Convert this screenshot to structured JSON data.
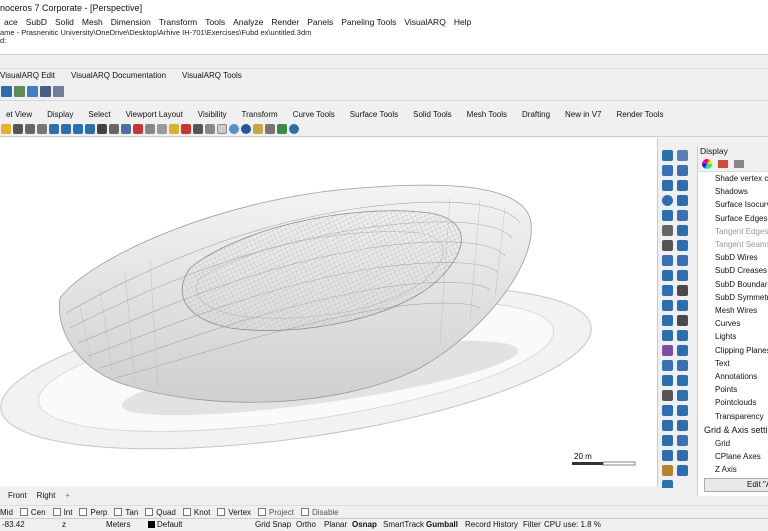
{
  "window": {
    "title": "noceros 7 Corporate - [Perspective]"
  },
  "menu": [
    "ace",
    "SubD",
    "Solid",
    "Mesh",
    "Dimension",
    "Transform",
    "Tools",
    "Analyze",
    "Render",
    "Panels",
    "Paneling Tools",
    "VisualARQ",
    "Help"
  ],
  "command_history": {
    "line1": "ame - Prasnenitic University\\OneDrive\\Desktop\\Arhive IH-701\\Exercises\\Fubd ex\\untitled.3dm",
    "line2": "d:"
  },
  "visualarq_tabs": [
    "VisualARQ Edit",
    "VisualARQ Documentation",
    "VisualARQ Tools"
  ],
  "main_tabs": [
    "et View",
    "Display",
    "Select",
    "Viewport Layout",
    "Visibility",
    "Transform",
    "Curve Tools",
    "Surface Tools",
    "Solid Tools",
    "Mesh Tools",
    "Drafting",
    "New in V7",
    "Render Tools"
  ],
  "viewport": {
    "name": "Perspective",
    "scale_label": "20 m"
  },
  "display_panel": {
    "header": "Display",
    "items": [
      {
        "label": "Shade vertex co",
        "dim": false
      },
      {
        "label": "Shadows",
        "dim": false
      },
      {
        "label": "Surface Isocurve",
        "dim": false
      },
      {
        "label": "Surface Edges",
        "dim": false
      },
      {
        "label": "Tangent Edges",
        "dim": true
      },
      {
        "label": "Tangent Seams",
        "dim": true
      },
      {
        "label": "SubD Wires",
        "dim": false
      },
      {
        "label": "SubD Creases",
        "dim": false
      },
      {
        "label": "SubD Boundarie",
        "dim": false
      },
      {
        "label": "SubD Symmetry",
        "dim": false
      },
      {
        "label": "Mesh Wires",
        "dim": false
      },
      {
        "label": "Curves",
        "dim": false
      },
      {
        "label": "Lights",
        "dim": false
      },
      {
        "label": "Clipping Planes",
        "dim": false
      },
      {
        "label": "Text",
        "dim": false
      },
      {
        "label": "Annotations",
        "dim": false
      },
      {
        "label": "Points",
        "dim": false
      },
      {
        "label": "Pointclouds",
        "dim": false
      },
      {
        "label": "Transparency",
        "dim": false
      }
    ],
    "grid_section": "Grid & Axis setti",
    "grid_items": [
      "Grid",
      "CPlane Axes",
      "Z Axis"
    ],
    "edit_button": "Edit \"A"
  },
  "view_tabs": [
    "Front",
    "Right",
    "+"
  ],
  "osnaps": [
    "Mid",
    "Cen",
    "Int",
    "Perp",
    "Tan",
    "Quad",
    "Knot",
    "Vertex",
    "Project",
    "Disable"
  ],
  "status": {
    "coord_x": "-83.42",
    "coord_z": "z",
    "units": "Meters",
    "layer": "Default",
    "grid_snap": "Grid Snap",
    "ortho": "Ortho",
    "planar": "Planar",
    "osnap": "Osnap",
    "smarttrack": "SmartTrack",
    "gumball": "Gumball",
    "record_history": "Record History",
    "filter": "Filter",
    "cpu": "CPU use: 1.8 %"
  }
}
